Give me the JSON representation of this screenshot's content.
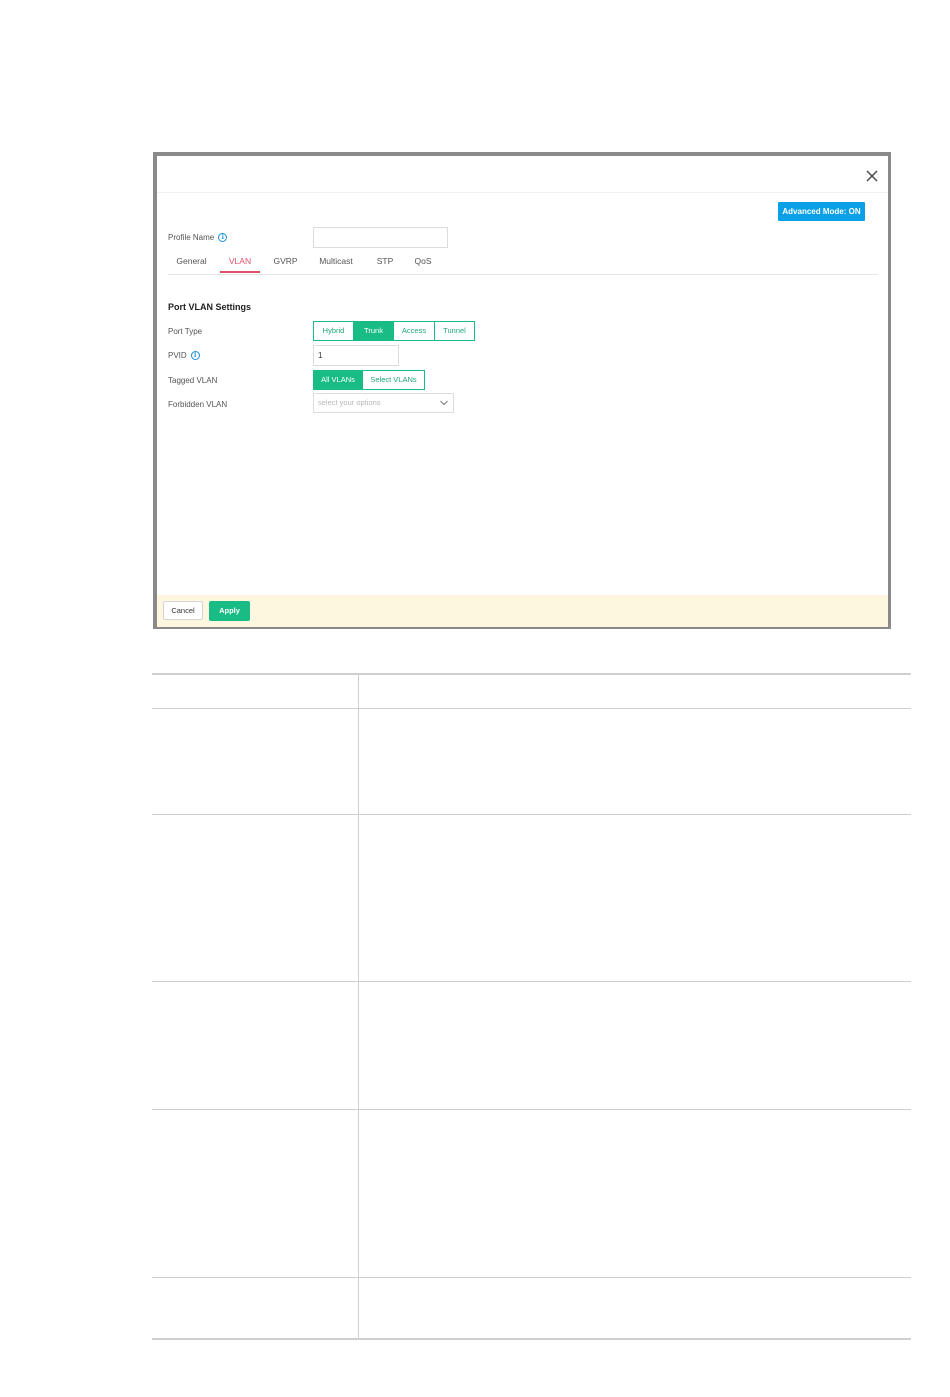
{
  "dialog": {
    "close_icon": "close-icon",
    "advanced_mode_label": "Advanced Mode: ON",
    "profile_name_label": "Profile Name",
    "profile_name_value": "",
    "tabs": [
      {
        "label": "General",
        "active": false
      },
      {
        "label": "VLAN",
        "active": true
      },
      {
        "label": "GVRP",
        "active": false
      },
      {
        "label": "Multicast",
        "active": false
      },
      {
        "label": "STP",
        "active": false
      },
      {
        "label": "QoS",
        "active": false
      }
    ],
    "section_title": "Port VLAN Settings",
    "port_type": {
      "label": "Port Type",
      "options": [
        "Hybrid",
        "Trunk",
        "Access",
        "Tunnel"
      ],
      "selected": "Trunk"
    },
    "pvid": {
      "label": "PVID",
      "value": "1"
    },
    "tagged_vlan": {
      "label": "Tagged VLAN",
      "options": [
        "All VLANs",
        "Select VLANs"
      ],
      "selected": "All VLANs"
    },
    "forbidden_vlan": {
      "label": "Forbidden VLAN",
      "placeholder": "select your options"
    },
    "footer": {
      "cancel_label": "Cancel",
      "apply_label": "Apply"
    }
  },
  "colors": {
    "accent_green": "#1abc86",
    "advanced_blue": "#0aa0e8",
    "active_tab": "#e0526e",
    "footer_bg": "#fdf7e0"
  }
}
